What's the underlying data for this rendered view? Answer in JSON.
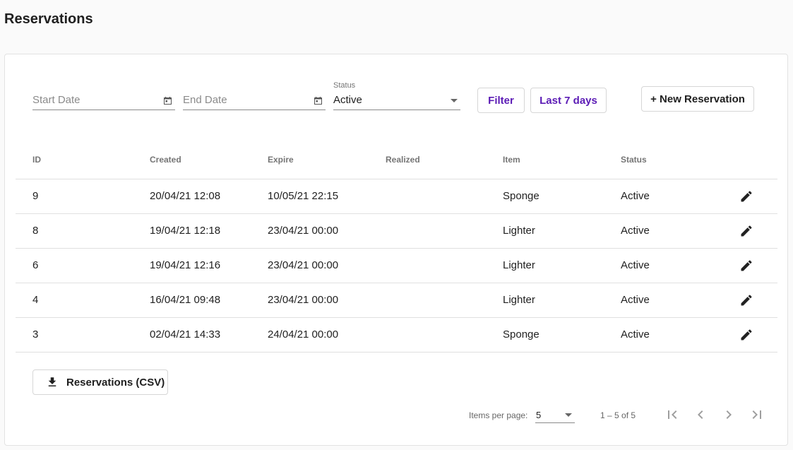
{
  "page": {
    "title": "Reservations"
  },
  "filters": {
    "start_date": {
      "placeholder": "Start Date",
      "value": ""
    },
    "end_date": {
      "placeholder": "End Date",
      "value": ""
    },
    "status": {
      "label": "Status",
      "value": "Active"
    },
    "filter_button": "Filter",
    "last7_button": "Last 7 days",
    "new_button": "+ New Reservation"
  },
  "table": {
    "columns": [
      "ID",
      "Created",
      "Expire",
      "Realized",
      "Item",
      "Status"
    ],
    "rows": [
      {
        "id": "9",
        "created": "20/04/21 12:08",
        "expire": "10/05/21 22:15",
        "realized": "",
        "item": "Sponge",
        "status": "Active"
      },
      {
        "id": "8",
        "created": "19/04/21 12:18",
        "expire": "23/04/21 00:00",
        "realized": "",
        "item": "Lighter",
        "status": "Active"
      },
      {
        "id": "6",
        "created": "19/04/21 12:16",
        "expire": "23/04/21 00:00",
        "realized": "",
        "item": "Lighter",
        "status": "Active"
      },
      {
        "id": "4",
        "created": "16/04/21 09:48",
        "expire": "23/04/21 00:00",
        "realized": "",
        "item": "Lighter",
        "status": "Active"
      },
      {
        "id": "3",
        "created": "02/04/21 14:33",
        "expire": "24/04/21 00:00",
        "realized": "",
        "item": "Sponge",
        "status": "Active"
      }
    ]
  },
  "export": {
    "label": "Reservations (CSV)",
    "icon": "download-icon"
  },
  "paginator": {
    "items_per_page_label": "Items per page:",
    "page_size": "5",
    "range_label": "1 – 5 of 5"
  },
  "colors": {
    "accent": "#5b1bb5",
    "text": "#212121",
    "muted": "#757575",
    "background": "#fafafa"
  }
}
